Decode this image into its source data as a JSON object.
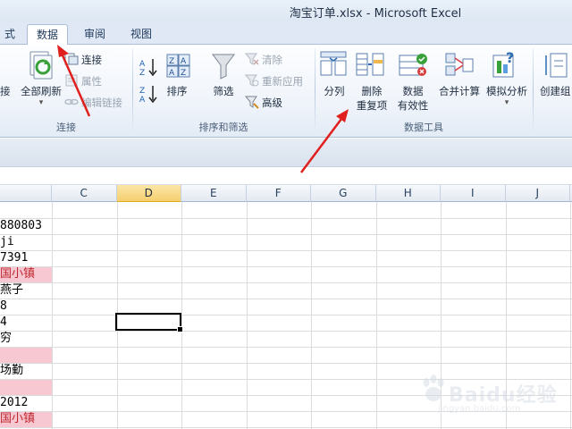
{
  "window": {
    "title": "淘宝订单.xlsx  -  Microsoft Excel"
  },
  "tabs": [
    {
      "label": "式"
    },
    {
      "label": "数据",
      "active": true
    },
    {
      "label": "审阅"
    },
    {
      "label": "视图"
    }
  ],
  "ribbon": {
    "groups": [
      {
        "label": "连接"
      },
      {
        "label": "排序和筛选"
      },
      {
        "label": "数据工具"
      }
    ],
    "connect": {
      "partial_left": "接",
      "refresh_all": "全部刷新",
      "connections": "连接",
      "properties": "属性",
      "edit_links": "编辑链接"
    },
    "sort_filter": {
      "sort": "排序",
      "filter": "筛选",
      "clear": "清除",
      "reapply": "重新应用",
      "advanced": "高级"
    },
    "data_tools": {
      "text_to_columns": "分列",
      "remove_duplicates_1": "删除",
      "remove_duplicates_2": "重复项",
      "validation_1": "数据",
      "validation_2": "有效性",
      "consolidate": "合并计算",
      "what_if": "模拟分析"
    },
    "outline": {
      "group_partial": "创建组"
    }
  },
  "columns": [
    "C",
    "D",
    "E",
    "F",
    "G",
    "H",
    "I",
    "J"
  ],
  "selected_column": "D",
  "cells": [
    {
      "text": "880803",
      "style": "normal"
    },
    {
      "text": "ji",
      "style": "normal"
    },
    {
      "text": "7391",
      "style": "normal"
    },
    {
      "text": "国小镇",
      "style": "red"
    },
    {
      "text": "燕子",
      "style": "cjk"
    },
    {
      "text": "8",
      "style": "normal"
    },
    {
      "text": "4",
      "style": "normal"
    },
    {
      "text": "穷",
      "style": "cjk"
    },
    {
      "text": "",
      "style": "pink"
    },
    {
      "text": "场勤",
      "style": "cjk"
    },
    {
      "text": "",
      "style": "pink"
    },
    {
      "text": "2012",
      "style": "normal"
    },
    {
      "text": "国小镇",
      "style": "red"
    }
  ],
  "watermark": {
    "text": "Baidu经验",
    "url": "jingyan.baidu.com"
  },
  "colors": {
    "accent_red": "#e0201f",
    "pink_fill": "#f7c8d2",
    "selected_col": "#f6cf6e"
  }
}
